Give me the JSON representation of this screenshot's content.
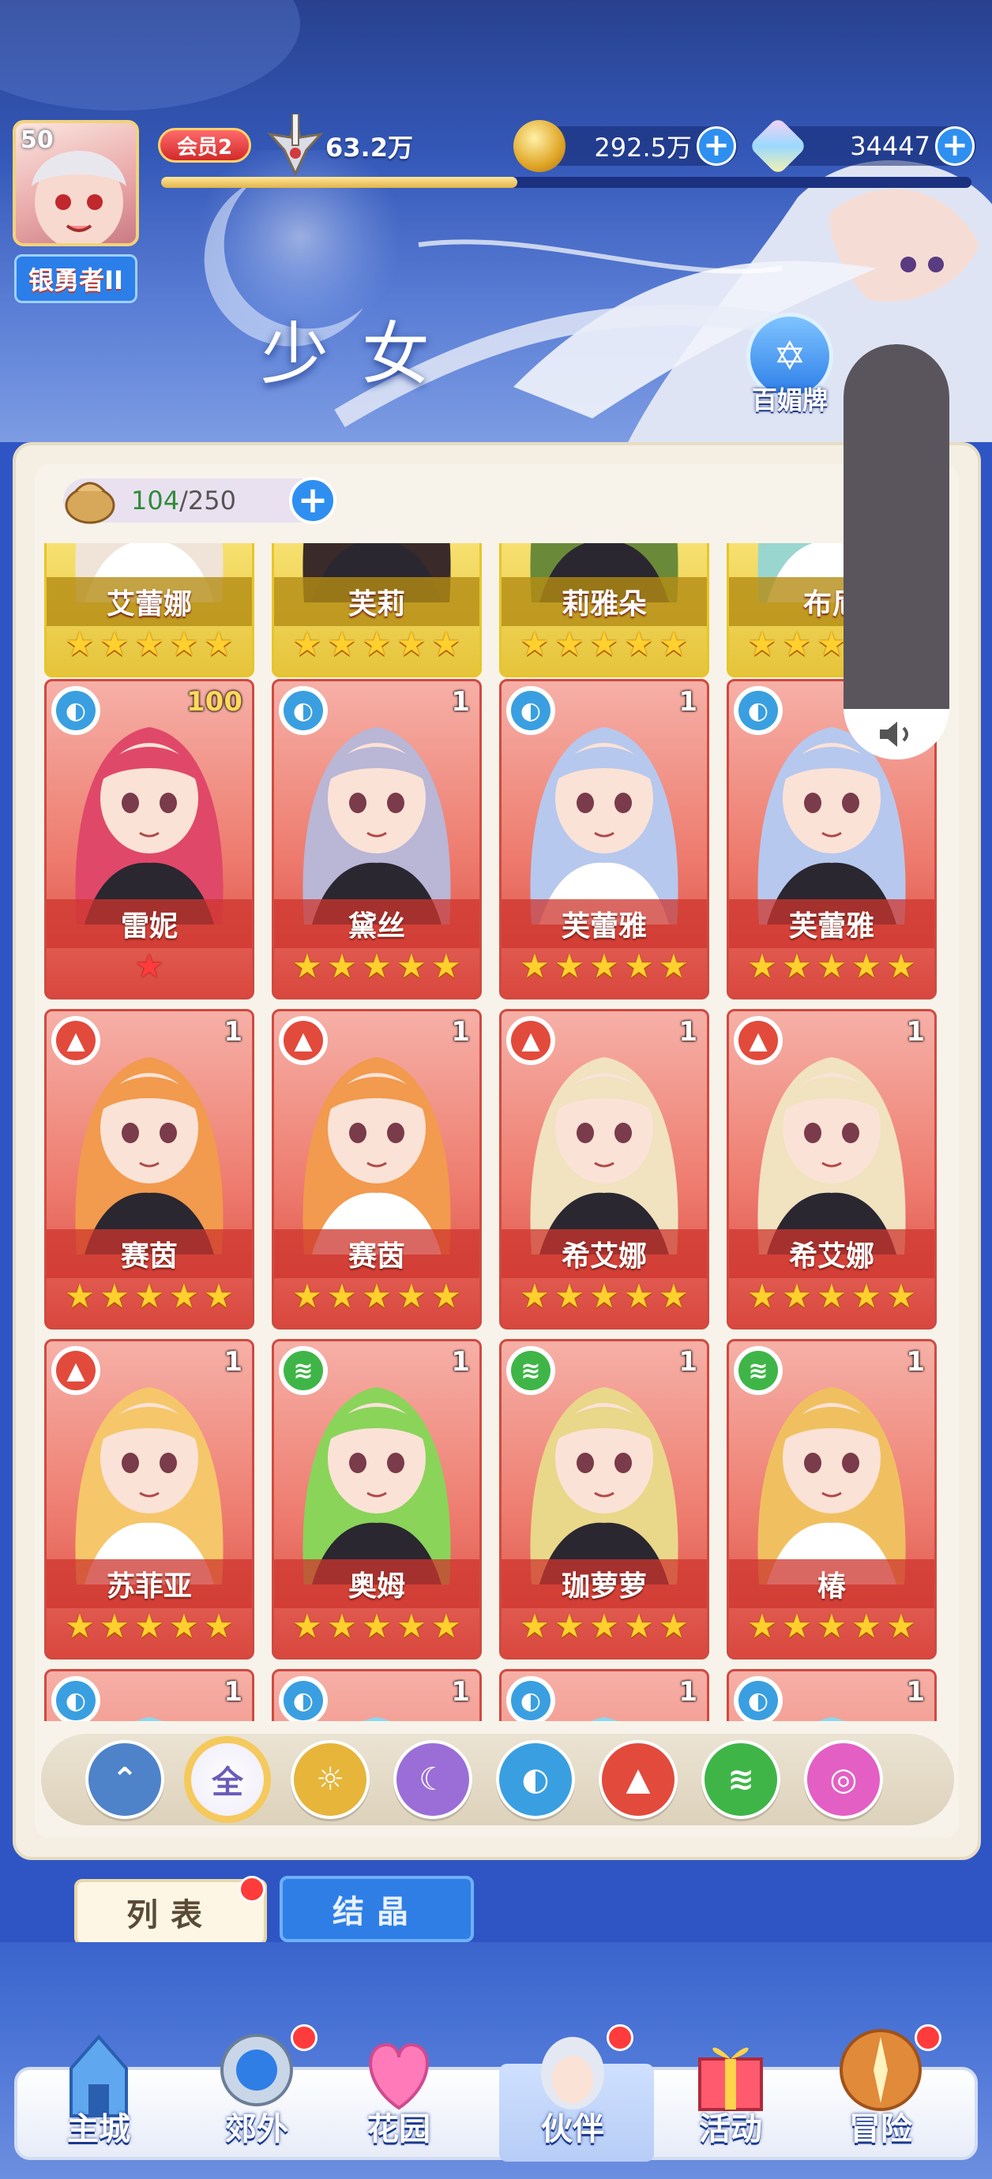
{
  "player": {
    "level": "50",
    "rank_title": "银勇者II",
    "vip_label": "会员2",
    "power": "63.2万",
    "gold": "292.5万",
    "gems": "34447",
    "xp_progress": 0.44
  },
  "header": {
    "section_title": "少女",
    "side_button_label": "百媚牌"
  },
  "roster": {
    "capacity_current": "104",
    "capacity_separator": "/",
    "capacity_max": "250"
  },
  "cards": [
    {
      "name": "艾蕾娜",
      "level": "",
      "element": "none",
      "stars": 5,
      "star_color": "gold",
      "frame": "gold"
    },
    {
      "name": "芙莉",
      "level": "",
      "element": "none",
      "stars": 5,
      "star_color": "gold",
      "frame": "gold"
    },
    {
      "name": "莉雅朵",
      "level": "",
      "element": "none",
      "stars": 5,
      "star_color": "gold",
      "frame": "gold"
    },
    {
      "name": "布尼",
      "level": "",
      "element": "none",
      "stars": 5,
      "star_color": "gold",
      "frame": "gold"
    },
    {
      "name": "雷妮",
      "level": "100",
      "element": "water",
      "stars": 1,
      "star_color": "red",
      "frame": "red"
    },
    {
      "name": "黛丝",
      "level": "1",
      "element": "water",
      "stars": 5,
      "star_color": "gold",
      "frame": "red"
    },
    {
      "name": "芙蕾雅",
      "level": "1",
      "element": "water",
      "stars": 5,
      "star_color": "gold",
      "frame": "red"
    },
    {
      "name": "芙蕾雅",
      "level": "1",
      "element": "water",
      "stars": 5,
      "star_color": "gold",
      "frame": "red"
    },
    {
      "name": "赛茵",
      "level": "1",
      "element": "fire",
      "stars": 5,
      "star_color": "gold",
      "frame": "red"
    },
    {
      "name": "赛茵",
      "level": "1",
      "element": "fire",
      "stars": 5,
      "star_color": "gold",
      "frame": "red"
    },
    {
      "name": "希艾娜",
      "level": "1",
      "element": "fire",
      "stars": 5,
      "star_color": "gold",
      "frame": "red"
    },
    {
      "name": "希艾娜",
      "level": "1",
      "element": "fire",
      "stars": 5,
      "star_color": "gold",
      "frame": "red"
    },
    {
      "name": "苏菲亚",
      "level": "1",
      "element": "fire",
      "stars": 5,
      "star_color": "gold",
      "frame": "red"
    },
    {
      "name": "奥姆",
      "level": "1",
      "element": "wind",
      "stars": 5,
      "star_color": "gold",
      "frame": "red"
    },
    {
      "name": "珈萝萝",
      "level": "1",
      "element": "wind",
      "stars": 5,
      "star_color": "gold",
      "frame": "red"
    },
    {
      "name": "椿",
      "level": "1",
      "element": "wind",
      "stars": 5,
      "star_color": "gold",
      "frame": "red"
    },
    {
      "name": "",
      "level": "1",
      "element": "water",
      "stars": 0,
      "star_color": "gold",
      "frame": "red"
    },
    {
      "name": "",
      "level": "1",
      "element": "water",
      "stars": 0,
      "star_color": "gold",
      "frame": "red"
    },
    {
      "name": "",
      "level": "1",
      "element": "water",
      "stars": 0,
      "star_color": "gold",
      "frame": "red"
    },
    {
      "name": "",
      "level": "1",
      "element": "water",
      "stars": 0,
      "star_color": "gold",
      "frame": "red"
    }
  ],
  "element_filters": [
    {
      "id": "sort",
      "label": "",
      "icon": "sort-arrow-icon",
      "color": "#4e83c9"
    },
    {
      "id": "all",
      "label": "全",
      "icon": "all-icon",
      "color": "#ffffff",
      "selected": true
    },
    {
      "id": "light",
      "label": "",
      "icon": "sun-icon",
      "color": "#e6b53a"
    },
    {
      "id": "dark",
      "label": "",
      "icon": "moon-icon",
      "color": "#9a6ed6"
    },
    {
      "id": "water",
      "label": "",
      "icon": "water-drop-icon",
      "color": "#3a9fe0"
    },
    {
      "id": "fire",
      "label": "",
      "icon": "flame-icon",
      "color": "#e24a3c"
    },
    {
      "id": "wind",
      "label": "",
      "icon": "wind-icon",
      "color": "#3fb548"
    },
    {
      "id": "chaos",
      "label": "",
      "icon": "planet-icon",
      "color": "#e35fc4"
    }
  ],
  "tabs": {
    "list": "列表",
    "crystal": "结晶"
  },
  "bottom_nav": [
    {
      "id": "main-city",
      "label": "主城",
      "badge": false
    },
    {
      "id": "outskirts",
      "label": "郊外",
      "badge": true
    },
    {
      "id": "garden",
      "label": "花园",
      "badge": false
    },
    {
      "id": "partner",
      "label": "伙伴",
      "badge": true,
      "active": true
    },
    {
      "id": "activity",
      "label": "活动",
      "badge": false
    },
    {
      "id": "adventure",
      "label": "冒险",
      "badge": true
    }
  ],
  "colors": {
    "water": "#3a9fe0",
    "fire": "#e24a3c",
    "wind": "#3fb548",
    "accent_blue": "#2f8ff0"
  }
}
